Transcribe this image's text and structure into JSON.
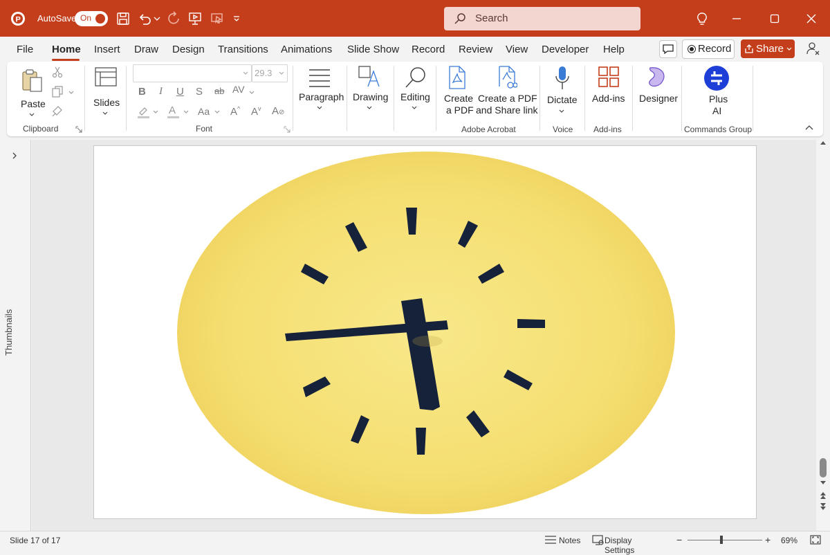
{
  "titlebar": {
    "autosave_label": "AutoSave",
    "autosave_state": "On",
    "search_placeholder": "Search",
    "accent": "#c43e1c"
  },
  "menu": {
    "tabs": [
      "File",
      "Home",
      "Insert",
      "Draw",
      "Design",
      "Transitions",
      "Animations",
      "Slide Show",
      "Record",
      "Review",
      "View",
      "Developer",
      "Help"
    ],
    "active_tab": "Home",
    "record_label": "Record",
    "share_label": "Share"
  },
  "ribbon": {
    "clipboard": {
      "paste_label": "Paste",
      "group_label": "Clipboard"
    },
    "slides": {
      "label": "Slides"
    },
    "font": {
      "font_name": "",
      "font_size": "29.3",
      "group_label": "Font"
    },
    "paragraph": {
      "label": "Paragraph"
    },
    "drawing": {
      "label": "Drawing"
    },
    "editing": {
      "label": "Editing"
    },
    "acrobat": {
      "create_pdf_line1": "Create",
      "create_pdf_line2": "a PDF",
      "share_pdf_line1": "Create a PDF",
      "share_pdf_line2": "and Share link",
      "group_label": "Adobe Acrobat"
    },
    "voice": {
      "dictate_label": "Dictate",
      "group_label": "Voice"
    },
    "addins": {
      "label": "Add-ins",
      "group_label": "Add-ins"
    },
    "designer": {
      "label": "Designer"
    },
    "plusai": {
      "line1": "Plus",
      "line2": "AI",
      "group_label": "Commands Group"
    }
  },
  "sidepanel": {
    "thumbnails_label": "Thumbnails"
  },
  "status": {
    "slide_info": "Slide 17 of 17",
    "notes_label": "Notes",
    "display_settings_label": "Display Settings",
    "zoom_level": "69%",
    "zoom_fraction": 0.45
  },
  "slide": {
    "clock_face_color": "#f7e37a",
    "hand_color": "#16213a"
  }
}
